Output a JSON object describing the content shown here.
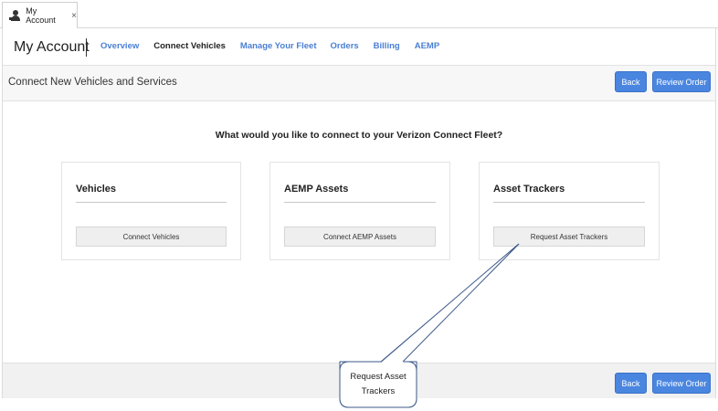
{
  "tab": {
    "label": "My Account",
    "close": "×"
  },
  "header": {
    "title": "My Account",
    "nav": [
      "Overview",
      "Connect Vehicles",
      "Manage Your Fleet",
      "Orders",
      "Billing",
      "AEMP"
    ]
  },
  "subheader": {
    "title": "Connect New Vehicles and Services",
    "back": "Back",
    "review": "Review Order"
  },
  "main": {
    "question": "What would you like to connect to your Verizon Connect Fleet?",
    "cards": [
      {
        "title": "Vehicles",
        "button": "Connect Vehicles"
      },
      {
        "title": "AEMP Assets",
        "button": "Connect AEMP Assets"
      },
      {
        "title": "Asset Trackers",
        "button": "Request Asset Trackers"
      }
    ]
  },
  "footer": {
    "back": "Back",
    "review": "Review Order"
  },
  "callout": {
    "line1": "Request Asset",
    "line2": "Trackers"
  },
  "colors": {
    "accent": "#4a86e0",
    "link": "#4a7fd4",
    "callout_border": "#3d5a8a"
  }
}
